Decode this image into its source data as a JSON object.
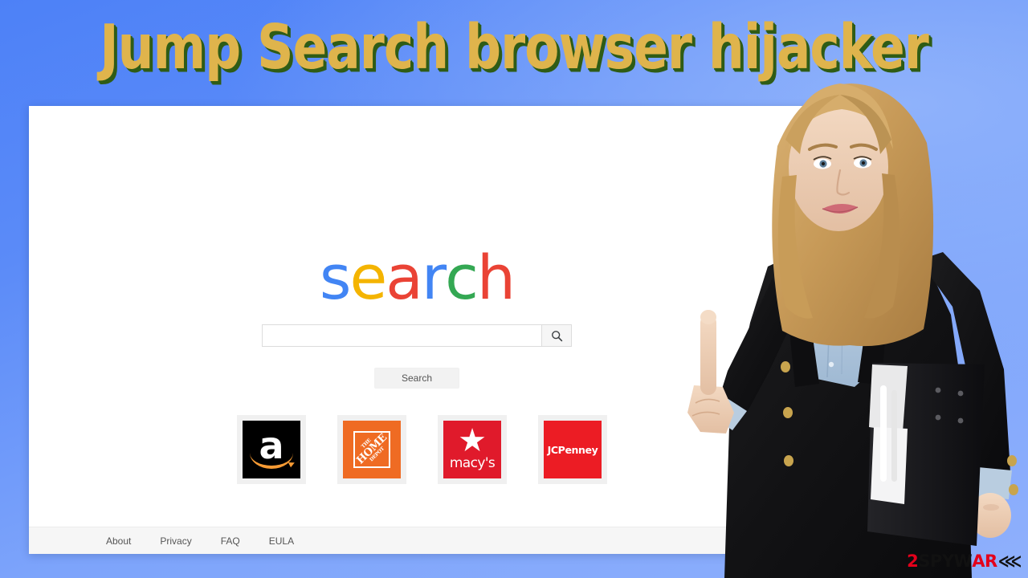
{
  "banner": {
    "title": "Jump Search browser hijacker",
    "title_color": "#dfb44c",
    "shadow_color": "#2f5c16",
    "background_color": "#5b8bf8"
  },
  "page": {
    "logo": {
      "text": "search",
      "letters": [
        {
          "char": "s",
          "color": "#4285f4"
        },
        {
          "char": "e",
          "color": "#f4b400"
        },
        {
          "char": "a",
          "color": "#ea4335"
        },
        {
          "char": "r",
          "color": "#4285f4"
        },
        {
          "char": "c",
          "color": "#34a853"
        },
        {
          "char": "h",
          "color": "#ea4335"
        }
      ]
    },
    "search": {
      "value": "",
      "placeholder": "",
      "go_icon": "search-icon",
      "button_label": "Search"
    },
    "tiles": [
      {
        "name": "Amazon",
        "letter": "a",
        "bg": "#000000",
        "accent": "#f79b34"
      },
      {
        "name": "The Home Depot",
        "line1": "THE",
        "line2": "HOME",
        "line3": "DEPOT",
        "bg": "#ef6b23",
        "accent": "#ffffff"
      },
      {
        "name": "Macy's",
        "word": "macy's",
        "bg": "#e01a2b",
        "accent": "#ffffff",
        "icon": "star-icon"
      },
      {
        "name": "JCPenney",
        "word": "JCPenney",
        "bg": "#ec1c24",
        "accent": "#ffffff"
      }
    ],
    "footer_links": [
      {
        "label": "About"
      },
      {
        "label": "Privacy"
      },
      {
        "label": "FAQ"
      },
      {
        "label": "EULA"
      }
    ]
  },
  "watermark": {
    "part1": "2",
    "part2": "SPYW",
    "part3": "AR",
    "chevron": "⋘",
    "color_red": "#e3001b",
    "color_dark": "#111111"
  }
}
